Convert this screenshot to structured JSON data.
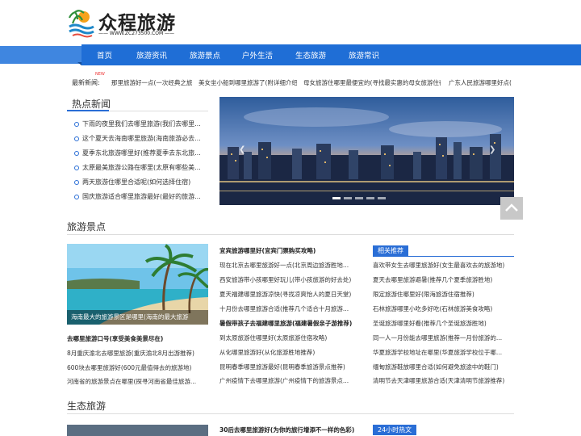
{
  "site": {
    "title": "众程旅游",
    "subtitle": "—— WWW.ZC273500.COM ——"
  },
  "nav": [
    "首页",
    "旅游资讯",
    "旅游景点",
    "户外生活",
    "生态旅游",
    "旅游常识"
  ],
  "ticker": {
    "label": "最新新闻:",
    "badge": "NEW",
    "items": [
      "那里旅游好一点(一次经典之旅)",
      "美女坐小船到哪里旅游了(附详细介绍)",
      "母女旅游住哪里最便宜的(寻找最实惠的母女旅游住宿)",
      "广东人民旅游哪里好点(广"
    ]
  },
  "hot_news": {
    "title": "热点新闻",
    "items": [
      "下雨的夜里我们去哪里旅游(我们去哪里...",
      "这个夏天去海南哪里旅游(海南旅游必去...",
      "夏季东北旅游哪里好(推荐夏季去东北旅...",
      "太原最美旅游公路在哪里(太原有哪些美...",
      "两天旅游住哪里合适呢(如何选择住宿)",
      "国庆旅游适合哪里旅游最好(最好的旅游..."
    ]
  },
  "scenic": {
    "title": "旅游景点",
    "photo_caption": "海南最大的旅游景区是哪里(海南的最大旅游",
    "left_items": [
      "去哪里旅游口号(享受美食美景尽在)",
      "8月重庆渝北去哪里旅游(重庆渝北8月出游推荐)",
      "600块去哪里旅游好(600元最值得去的旅游地)",
      "河南省的旅游景点在哪里(探寻河南省最佳旅游..."
    ],
    "mid_items": [
      "宜宾旅游哪里好(宜宾门票购买攻略)",
      "现在北京去哪里旅游好一点(北京周边旅游胜地...",
      "西安旅游带小孩哪里好玩儿(带小孩旅游的好去处)",
      "夏天福建哪里旅游凉快(寻找凉爽怡人的夏日天堂)",
      "十月份去哪里旅游合适(推荐几个适合十月旅游...",
      "暑假带孩子去福建哪里旅游(福建暑假亲子游推荐)",
      "到太原旅游住哪里好(太原旅游住宿攻略)",
      "从化哪里旅游好(从化旅游胜地推荐)",
      "昆明春季哪里旅游最好(昆明春季旅游景点推荐)",
      "广州疫情下去哪里旅游(广州疫情下的旅游景点..."
    ],
    "side_title": "相关推荐",
    "side_items": [
      "喜欢带女生去哪里旅游好(女生最喜欢去的旅游地)",
      "夏天去哪里旅游避暑(推荐几个夏季旅游胜地)",
      "限定旅游住哪里好(限海旅游住宿推荐)",
      "石林旅游哪里小吃多好吃(石林旅游美食攻略)",
      "圣诞旅游哪里好看(推荐几个圣诞旅游胜地)",
      "同一人一月份能去哪里旅游(推荐一月份旅游的...",
      "华夏旅游学校地址在哪里(华夏旅游学校位于哪...",
      "缅甸旅游鞋放哪里合适(如何避免旅途中的鞋门)",
      "清明节去天津哪里旅游合适(天津清明节旅游推荐)"
    ]
  },
  "eco": {
    "title": "生态旅游",
    "first_item": "30后去哪里旅游好(为你的旅行增添不一样的色彩)",
    "side_title": "24小时热文"
  },
  "colors": {
    "brand": "#2a6ed6",
    "nav": "#1f6ed6"
  }
}
